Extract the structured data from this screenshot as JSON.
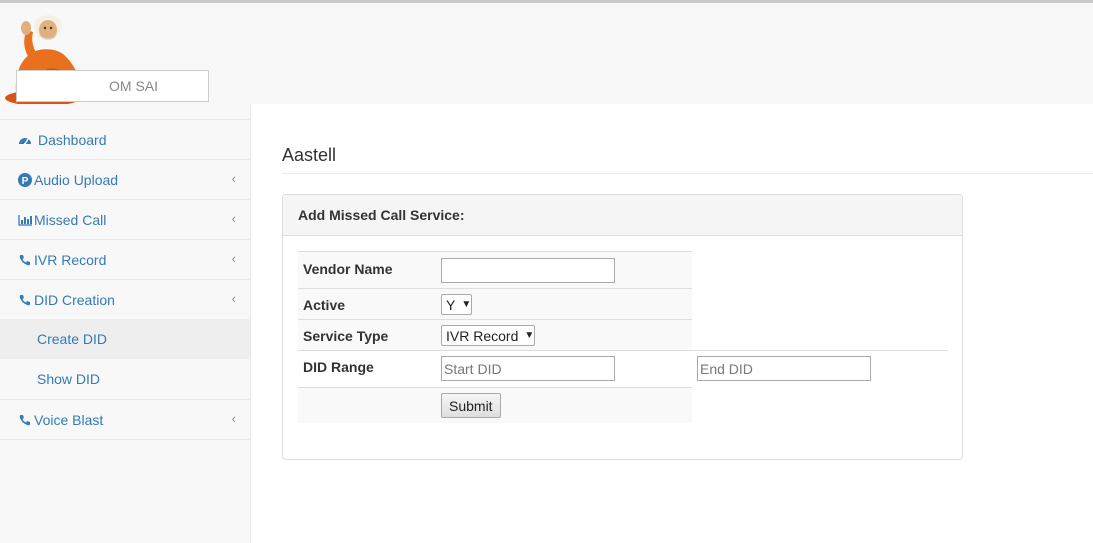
{
  "brand": {
    "name": "OM SAI"
  },
  "sidebar": {
    "items": [
      {
        "label": "Dashboard",
        "icon": "dashboard-icon",
        "has_chevron": false
      },
      {
        "label": "Audio Upload",
        "icon": "circle-p-icon",
        "has_chevron": true
      },
      {
        "label": "Missed Call",
        "icon": "bar-chart-icon",
        "has_chevron": true
      },
      {
        "label": "IVR Record",
        "icon": "phone-icon",
        "has_chevron": true
      },
      {
        "label": "DID Creation",
        "icon": "phone-icon",
        "has_chevron": true,
        "expanded": true,
        "subitems": [
          {
            "label": "Create DID",
            "active": true
          },
          {
            "label": "Show DID",
            "active": false
          }
        ]
      },
      {
        "label": "Voice Blast",
        "icon": "phone-icon",
        "has_chevron": true
      }
    ],
    "chevron_glyph": "‹"
  },
  "page": {
    "title": "Aastell"
  },
  "panel": {
    "heading": "Add Missed Call Service:",
    "fields": {
      "vendor_name": {
        "label": "Vendor Name",
        "value": ""
      },
      "active": {
        "label": "Active",
        "value": "Y"
      },
      "service_type": {
        "label": "Service Type",
        "value": "IVR Record"
      },
      "did_range": {
        "label": "DID Range",
        "start_placeholder": "Start DID",
        "end_placeholder": "End DID"
      }
    },
    "submit_label": "Submit"
  },
  "colors": {
    "link": "#337ab7",
    "heading_bg": "#f5f5f5",
    "row_bg": "#f9f9f9",
    "sidebar_bg": "#f8f8f8",
    "robe": "#e8701e"
  }
}
